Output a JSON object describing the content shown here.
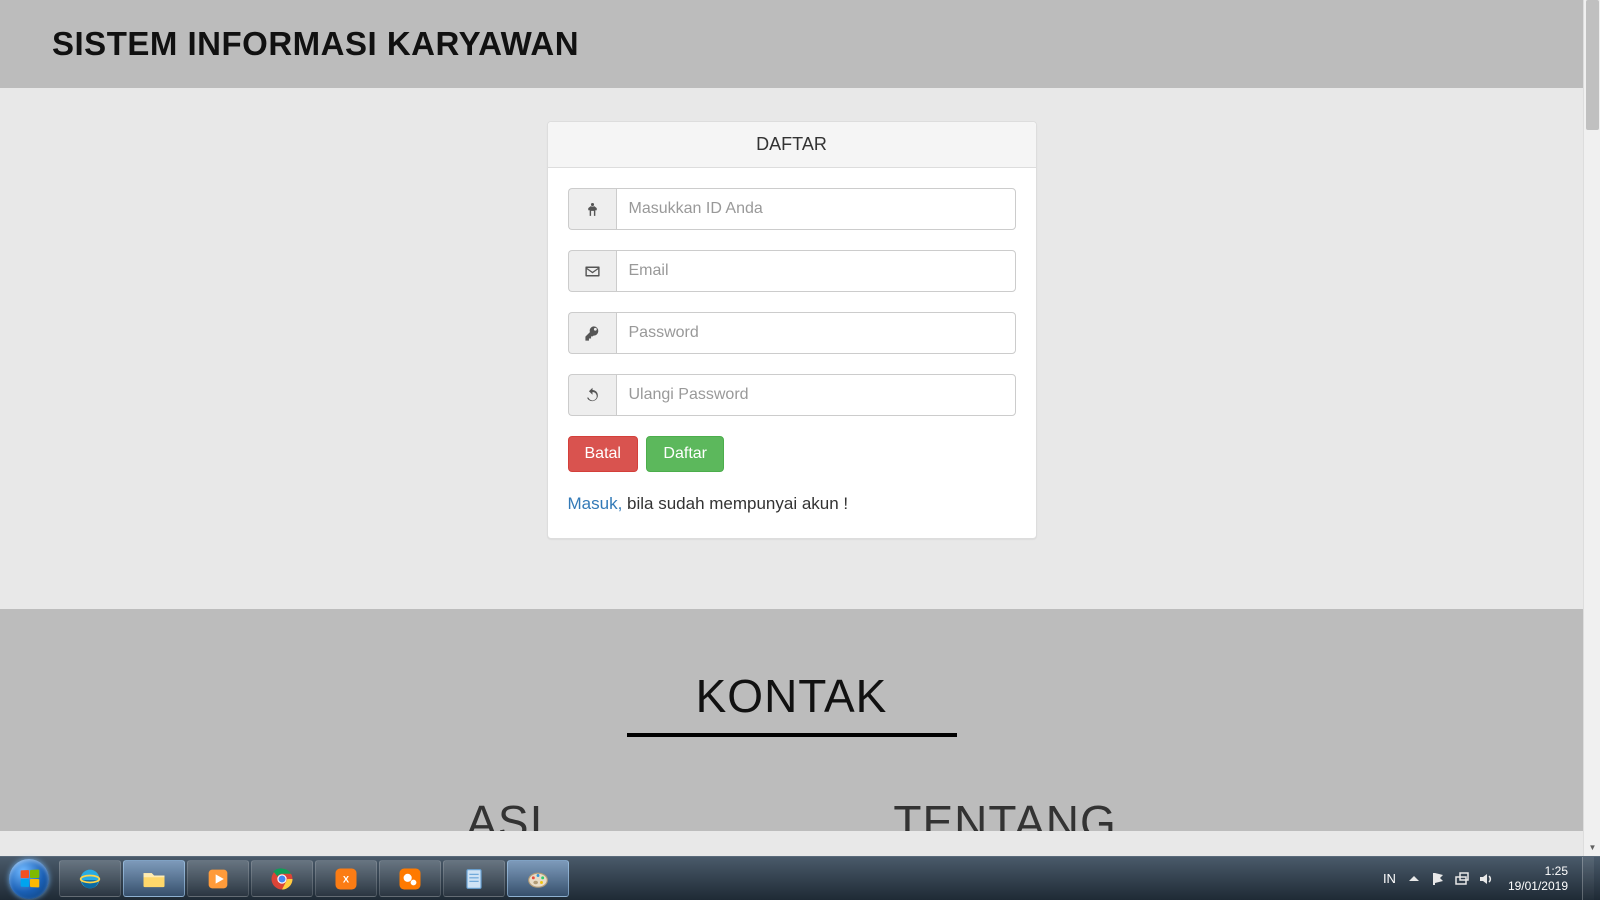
{
  "header": {
    "title": "SISTEM INFORMASI KARYAWAN"
  },
  "panel": {
    "heading": "DAFTAR",
    "fields": {
      "id": {
        "placeholder": "Masukkan ID Anda",
        "value": ""
      },
      "email": {
        "placeholder": "Email",
        "value": ""
      },
      "password": {
        "placeholder": "Password",
        "value": ""
      },
      "repeat": {
        "placeholder": "Ulangi Password",
        "value": ""
      }
    },
    "buttons": {
      "cancel": "Batal",
      "submit": "Daftar"
    },
    "login_link": "Masuk,",
    "login_text_rest": " bila sudah mempunyai akun !"
  },
  "footer": {
    "title": "KONTAK",
    "partial_left": "ASI",
    "partial_right": "TENTANG"
  },
  "taskbar": {
    "lang": "IN",
    "time": "1:25",
    "date": "19/01/2019"
  }
}
